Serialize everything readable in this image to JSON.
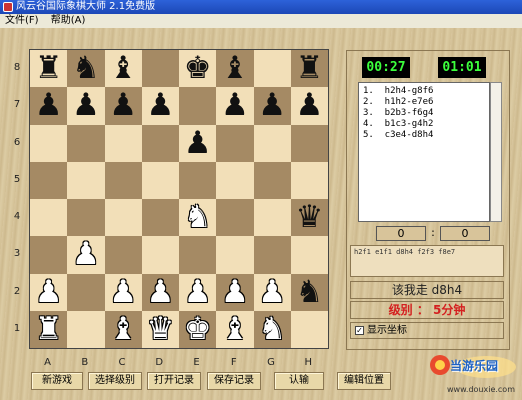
{
  "window": {
    "title": "风云谷国际象棋大师 2.1免费版"
  },
  "menu": {
    "items": [
      "文件(F)",
      "帮助(A)"
    ]
  },
  "board": {
    "ranks": [
      "8",
      "7",
      "6",
      "5",
      "4",
      "3",
      "2",
      "1"
    ],
    "files": [
      "A",
      "B",
      "C",
      "D",
      "E",
      "F",
      "G",
      "H"
    ],
    "rows": [
      [
        "r",
        "n",
        "b",
        "",
        "k",
        "b",
        "",
        "r"
      ],
      [
        "p",
        "p",
        "p",
        "p",
        "",
        "p",
        "p",
        "p"
      ],
      [
        "",
        "",
        "",
        "",
        "p",
        "",
        "",
        ""
      ],
      [
        "",
        "",
        "",
        "",
        "",
        "",
        "",
        ""
      ],
      [
        "",
        "",
        "",
        "",
        "N",
        "",
        "",
        "q"
      ],
      [
        "",
        "P",
        "",
        "",
        "",
        "",
        "",
        ""
      ],
      [
        "P",
        "",
        "P",
        "P",
        "P",
        "P",
        "P",
        "n"
      ],
      [
        "R",
        "",
        "B",
        "Q",
        "K",
        "B",
        "N",
        ""
      ]
    ]
  },
  "clocks": {
    "left": "00:27",
    "right": "01:01"
  },
  "moves": [
    "1.  h2h4-g8f6",
    "2.  h1h2-e7e6",
    "3.  b2b3-f6g4",
    "4.  b1c3-g4h2",
    "5.  c3e4-d8h4"
  ],
  "score": {
    "left": "0",
    "separator": ":",
    "right": "0"
  },
  "hints": "h2f1  e1f1  d8h4  f2f3  f8e7",
  "status": {
    "move_text": "该我走  d8h4",
    "level_text": "级别 ： 5分钟"
  },
  "options": {
    "show_coords_label": "显示坐标",
    "show_coords_checked": true
  },
  "buttons": [
    "新游戏",
    "选择级别",
    "打开记录",
    "保存记录",
    "认输",
    "编辑位置"
  ],
  "logo": {
    "title": "当游乐园",
    "url": "www.douxie.com"
  },
  "colors": {
    "clock_text": "#3cff3c",
    "status_red": "#d42020",
    "title_bar": "#2d62d9"
  }
}
